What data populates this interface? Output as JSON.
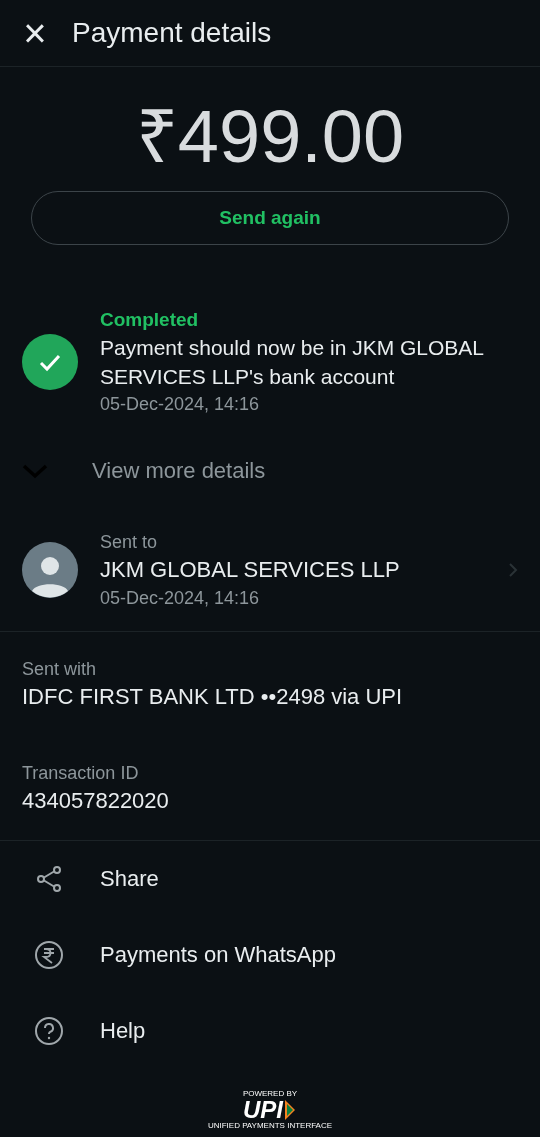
{
  "header": {
    "close": "×",
    "title": "Payment details"
  },
  "amount": "₹499.00",
  "send_again": "Send again",
  "status": {
    "label": "Completed",
    "kind": "success",
    "message": "Payment should now be in JKM GLOBAL SERVICES LLP's bank account",
    "time": "05-Dec-2024, 14:16"
  },
  "view_more": {
    "label": "View more details",
    "expanded": false
  },
  "recipient": {
    "label": "Sent to",
    "name": "JKM GLOBAL SERVICES LLP",
    "time": "05-Dec-2024, 14:16"
  },
  "details": [
    {
      "label": "Sent with",
      "value": "IDFC FIRST BANK LTD ••2498 via UPI"
    },
    {
      "label": "Transaction ID",
      "value": "434057822020"
    }
  ],
  "actions": [
    {
      "kind": "share",
      "label": "Share"
    },
    {
      "kind": "rupee",
      "label": "Payments on WhatsApp"
    },
    {
      "kind": "help",
      "label": "Help"
    }
  ],
  "footer": {
    "powered_by": "POWERED BY",
    "logo": "UPI",
    "tagline": "UNIFIED PAYMENTS INTERFACE"
  }
}
